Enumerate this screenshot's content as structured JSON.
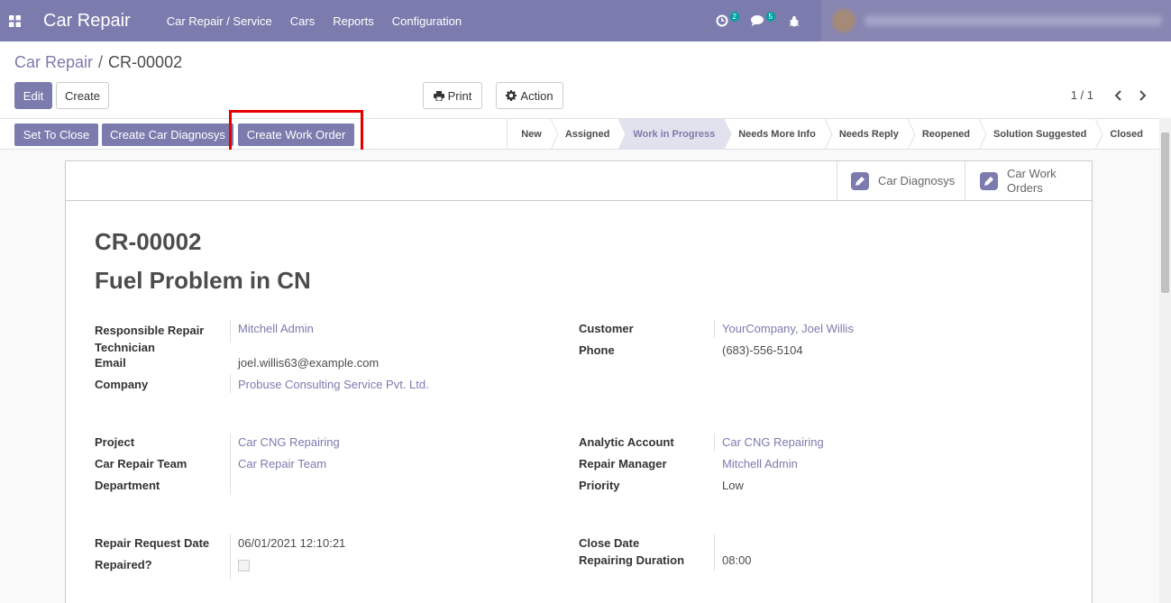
{
  "navbar": {
    "brand": "Car Repair",
    "menu": [
      "Car Repair / Service",
      "Cars",
      "Reports",
      "Configuration"
    ],
    "activity_count": "2",
    "message_count": "5"
  },
  "breadcrumb": {
    "parent": "Car Repair",
    "separator": "/",
    "current": "CR-00002"
  },
  "controls": {
    "edit": "Edit",
    "create": "Create",
    "print": "Print",
    "action": "Action",
    "pager": "1 / 1"
  },
  "statusbar": {
    "buttons": [
      "Set To Close",
      "Create Car Diagnosys",
      "Create Work Order"
    ],
    "stages": [
      "New",
      "Assigned",
      "Work in Progress",
      "Needs More Info",
      "Needs Reply",
      "Reopened",
      "Solution Suggested",
      "Closed"
    ],
    "active_stage": "Work in Progress"
  },
  "smart_buttons": {
    "diagnosys": "Car Diagnosys",
    "work_orders_line1": "Car Work",
    "work_orders_line2": "Orders"
  },
  "record": {
    "ref": "CR-00002",
    "name": "Fuel Problem in CN",
    "fields": {
      "technician_label_1": "Responsible Repair",
      "technician_label_2": "Technician",
      "technician": "Mitchell Admin",
      "email_label": "Email",
      "email": "joel.willis63@example.com",
      "company_label": "Company",
      "company": "Probuse Consulting Service Pvt. Ltd.",
      "customer_label": "Customer",
      "customer": "YourCompany, Joel Willis",
      "phone_label": "Phone",
      "phone": "(683)-556-5104",
      "project_label": "Project",
      "project": "Car CNG Repairing",
      "team_label": "Car Repair Team",
      "team": "Car Repair Team",
      "department_label": "Department",
      "analytic_label": "Analytic Account",
      "analytic": "Car CNG Repairing",
      "manager_label": "Repair Manager",
      "manager": "Mitchell Admin",
      "priority_label": "Priority",
      "priority": "Low",
      "request_date_label": "Repair Request Date",
      "request_date": "06/01/2021 12:10:21",
      "repaired_label": "Repaired?",
      "close_date_label": "Close Date",
      "duration_label": "Repairing Duration",
      "duration": "08:00"
    }
  },
  "colors": {
    "brand": "#7c7bad",
    "highlight": "#e60000",
    "badge": "#00a09d"
  }
}
